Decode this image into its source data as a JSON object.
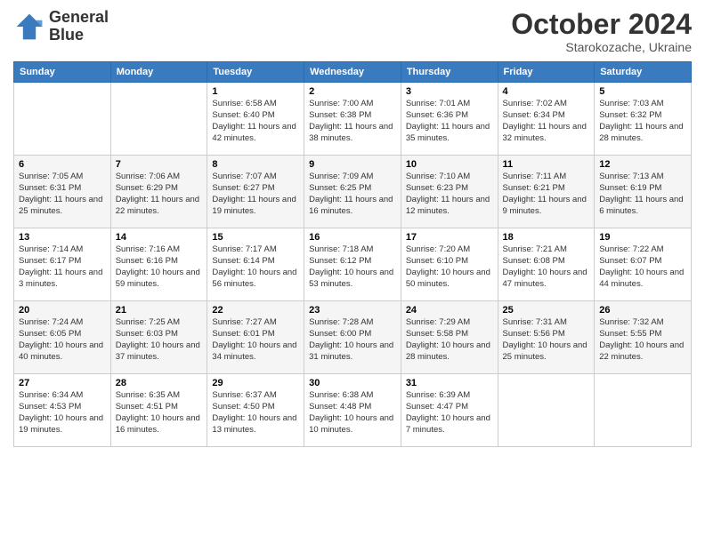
{
  "logo": {
    "line1": "General",
    "line2": "Blue"
  },
  "title": "October 2024",
  "location": "Starokozache, Ukraine",
  "days_header": [
    "Sunday",
    "Monday",
    "Tuesday",
    "Wednesday",
    "Thursday",
    "Friday",
    "Saturday"
  ],
  "weeks": [
    [
      {
        "num": "",
        "sunrise": "",
        "sunset": "",
        "daylight": ""
      },
      {
        "num": "",
        "sunrise": "",
        "sunset": "",
        "daylight": ""
      },
      {
        "num": "1",
        "sunrise": "Sunrise: 6:58 AM",
        "sunset": "Sunset: 6:40 PM",
        "daylight": "Daylight: 11 hours and 42 minutes."
      },
      {
        "num": "2",
        "sunrise": "Sunrise: 7:00 AM",
        "sunset": "Sunset: 6:38 PM",
        "daylight": "Daylight: 11 hours and 38 minutes."
      },
      {
        "num": "3",
        "sunrise": "Sunrise: 7:01 AM",
        "sunset": "Sunset: 6:36 PM",
        "daylight": "Daylight: 11 hours and 35 minutes."
      },
      {
        "num": "4",
        "sunrise": "Sunrise: 7:02 AM",
        "sunset": "Sunset: 6:34 PM",
        "daylight": "Daylight: 11 hours and 32 minutes."
      },
      {
        "num": "5",
        "sunrise": "Sunrise: 7:03 AM",
        "sunset": "Sunset: 6:32 PM",
        "daylight": "Daylight: 11 hours and 28 minutes."
      }
    ],
    [
      {
        "num": "6",
        "sunrise": "Sunrise: 7:05 AM",
        "sunset": "Sunset: 6:31 PM",
        "daylight": "Daylight: 11 hours and 25 minutes."
      },
      {
        "num": "7",
        "sunrise": "Sunrise: 7:06 AM",
        "sunset": "Sunset: 6:29 PM",
        "daylight": "Daylight: 11 hours and 22 minutes."
      },
      {
        "num": "8",
        "sunrise": "Sunrise: 7:07 AM",
        "sunset": "Sunset: 6:27 PM",
        "daylight": "Daylight: 11 hours and 19 minutes."
      },
      {
        "num": "9",
        "sunrise": "Sunrise: 7:09 AM",
        "sunset": "Sunset: 6:25 PM",
        "daylight": "Daylight: 11 hours and 16 minutes."
      },
      {
        "num": "10",
        "sunrise": "Sunrise: 7:10 AM",
        "sunset": "Sunset: 6:23 PM",
        "daylight": "Daylight: 11 hours and 12 minutes."
      },
      {
        "num": "11",
        "sunrise": "Sunrise: 7:11 AM",
        "sunset": "Sunset: 6:21 PM",
        "daylight": "Daylight: 11 hours and 9 minutes."
      },
      {
        "num": "12",
        "sunrise": "Sunrise: 7:13 AM",
        "sunset": "Sunset: 6:19 PM",
        "daylight": "Daylight: 11 hours and 6 minutes."
      }
    ],
    [
      {
        "num": "13",
        "sunrise": "Sunrise: 7:14 AM",
        "sunset": "Sunset: 6:17 PM",
        "daylight": "Daylight: 11 hours and 3 minutes."
      },
      {
        "num": "14",
        "sunrise": "Sunrise: 7:16 AM",
        "sunset": "Sunset: 6:16 PM",
        "daylight": "Daylight: 10 hours and 59 minutes."
      },
      {
        "num": "15",
        "sunrise": "Sunrise: 7:17 AM",
        "sunset": "Sunset: 6:14 PM",
        "daylight": "Daylight: 10 hours and 56 minutes."
      },
      {
        "num": "16",
        "sunrise": "Sunrise: 7:18 AM",
        "sunset": "Sunset: 6:12 PM",
        "daylight": "Daylight: 10 hours and 53 minutes."
      },
      {
        "num": "17",
        "sunrise": "Sunrise: 7:20 AM",
        "sunset": "Sunset: 6:10 PM",
        "daylight": "Daylight: 10 hours and 50 minutes."
      },
      {
        "num": "18",
        "sunrise": "Sunrise: 7:21 AM",
        "sunset": "Sunset: 6:08 PM",
        "daylight": "Daylight: 10 hours and 47 minutes."
      },
      {
        "num": "19",
        "sunrise": "Sunrise: 7:22 AM",
        "sunset": "Sunset: 6:07 PM",
        "daylight": "Daylight: 10 hours and 44 minutes."
      }
    ],
    [
      {
        "num": "20",
        "sunrise": "Sunrise: 7:24 AM",
        "sunset": "Sunset: 6:05 PM",
        "daylight": "Daylight: 10 hours and 40 minutes."
      },
      {
        "num": "21",
        "sunrise": "Sunrise: 7:25 AM",
        "sunset": "Sunset: 6:03 PM",
        "daylight": "Daylight: 10 hours and 37 minutes."
      },
      {
        "num": "22",
        "sunrise": "Sunrise: 7:27 AM",
        "sunset": "Sunset: 6:01 PM",
        "daylight": "Daylight: 10 hours and 34 minutes."
      },
      {
        "num": "23",
        "sunrise": "Sunrise: 7:28 AM",
        "sunset": "Sunset: 6:00 PM",
        "daylight": "Daylight: 10 hours and 31 minutes."
      },
      {
        "num": "24",
        "sunrise": "Sunrise: 7:29 AM",
        "sunset": "Sunset: 5:58 PM",
        "daylight": "Daylight: 10 hours and 28 minutes."
      },
      {
        "num": "25",
        "sunrise": "Sunrise: 7:31 AM",
        "sunset": "Sunset: 5:56 PM",
        "daylight": "Daylight: 10 hours and 25 minutes."
      },
      {
        "num": "26",
        "sunrise": "Sunrise: 7:32 AM",
        "sunset": "Sunset: 5:55 PM",
        "daylight": "Daylight: 10 hours and 22 minutes."
      }
    ],
    [
      {
        "num": "27",
        "sunrise": "Sunrise: 6:34 AM",
        "sunset": "Sunset: 4:53 PM",
        "daylight": "Daylight: 10 hours and 19 minutes."
      },
      {
        "num": "28",
        "sunrise": "Sunrise: 6:35 AM",
        "sunset": "Sunset: 4:51 PM",
        "daylight": "Daylight: 10 hours and 16 minutes."
      },
      {
        "num": "29",
        "sunrise": "Sunrise: 6:37 AM",
        "sunset": "Sunset: 4:50 PM",
        "daylight": "Daylight: 10 hours and 13 minutes."
      },
      {
        "num": "30",
        "sunrise": "Sunrise: 6:38 AM",
        "sunset": "Sunset: 4:48 PM",
        "daylight": "Daylight: 10 hours and 10 minutes."
      },
      {
        "num": "31",
        "sunrise": "Sunrise: 6:39 AM",
        "sunset": "Sunset: 4:47 PM",
        "daylight": "Daylight: 10 hours and 7 minutes."
      },
      {
        "num": "",
        "sunrise": "",
        "sunset": "",
        "daylight": ""
      },
      {
        "num": "",
        "sunrise": "",
        "sunset": "",
        "daylight": ""
      }
    ]
  ]
}
